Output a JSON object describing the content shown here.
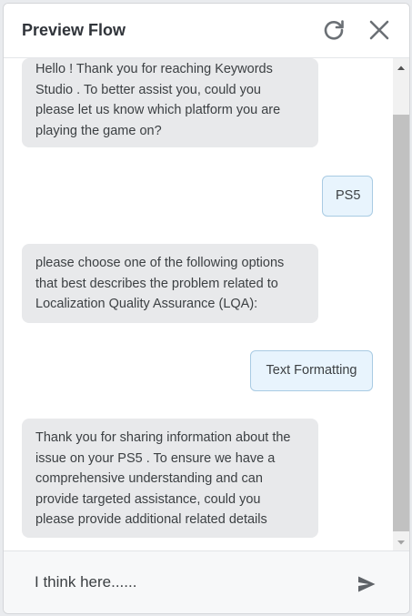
{
  "header": {
    "title": "Preview Flow",
    "refresh_icon": "refresh-icon",
    "close_icon": "close-icon"
  },
  "messages": [
    {
      "from": "bot",
      "text": "Hello ! Thank you for reaching Keywords\nStudio . To better assist you, could you\nplease let us know which platform you are\nplaying the game on?"
    },
    {
      "from": "user",
      "text": "PS5"
    },
    {
      "from": "bot",
      "text": "please choose one of the following options\nthat best describes the problem related to\nLocalization Quality Assurance (LQA):"
    },
    {
      "from": "user",
      "text": "Text Formatting"
    },
    {
      "from": "bot",
      "text": "Thank you for sharing information about the\nissue on your PS5 . To ensure we have a\ncomprehensive understanding and can\nprovide targeted assistance, could you\nplease provide additional related details"
    }
  ],
  "composer": {
    "placeholder": "I think here......",
    "send_icon": "send-icon"
  },
  "colors": {
    "bot_bubble": "#e8e9eb",
    "user_bubble": "#e8f4fd",
    "user_border": "#a9cbe3",
    "text": "#3c4043"
  }
}
